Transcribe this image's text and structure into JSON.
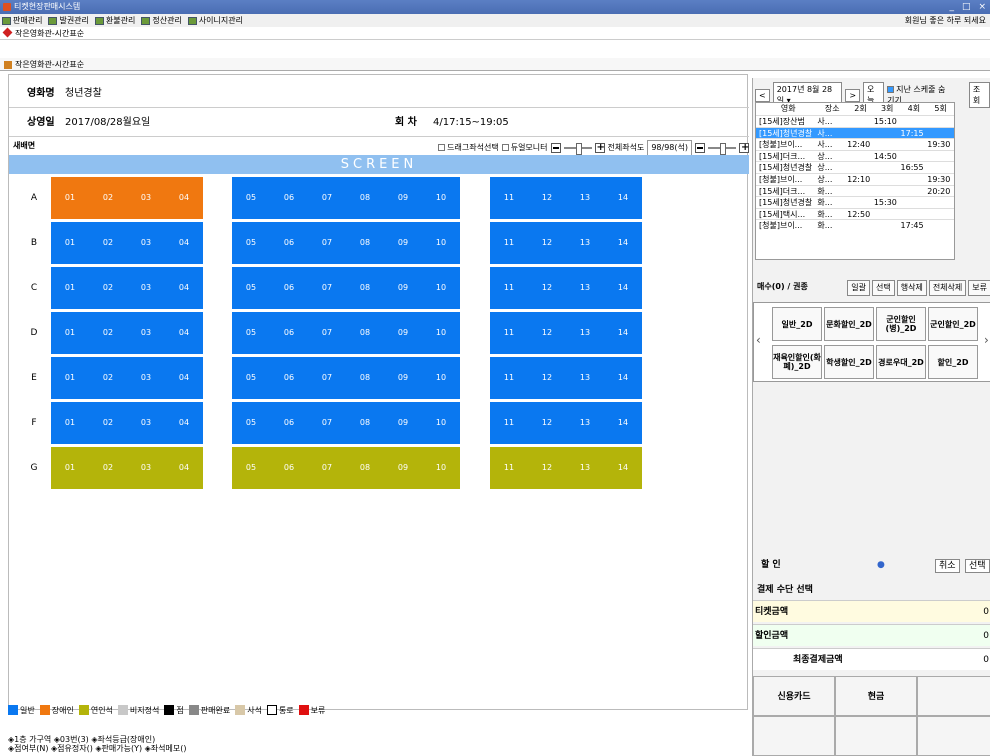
{
  "window": {
    "title": "티켓현장판매시스템",
    "controls": [
      "_",
      "□",
      "×"
    ]
  },
  "menu": {
    "items": [
      "판매관리",
      "발권관리",
      "환불관리",
      "정산관리",
      "사이니지관리"
    ],
    "greeting": "회원님 좋은 하루 되세요"
  },
  "tab": {
    "label": "작은영화관-시간표순"
  },
  "subtitle": "작은영화관-시간표순",
  "info": {
    "movie_label": "영화명",
    "movie": "청년경찰",
    "date_label": "상영일",
    "date": "2017/08/28월요일",
    "session_label": "회 차",
    "session": "4/17:15~19:05"
  },
  "toolbar": {
    "screen_label": "새배면",
    "drag_select": "드래그좌석선택",
    "dual_monitor": "듀얼모니터",
    "full_seat_label": "전체좌석도",
    "seat_count": "98/98(석)"
  },
  "screen_label": "SCREEN",
  "seat_rows": [
    "A",
    "B",
    "C",
    "D",
    "E",
    "F",
    "G"
  ],
  "seat_numbers": [
    "01",
    "02",
    "03",
    "04",
    "05",
    "06",
    "07",
    "08",
    "09",
    "10",
    "11",
    "12",
    "13",
    "14"
  ],
  "colors": {
    "normal": "#0a78f0",
    "disabled": "#f07810",
    "companion": "#b4b40a",
    "screen": "#90c0f0",
    "selected_row": "#3399ff"
  },
  "legend": [
    "일반",
    "장애인",
    "연인석",
    "비지정석",
    "점",
    "판매완료",
    "사석",
    "통로",
    "보류"
  ],
  "status": {
    "line1": "◈1층 가구역  ◈03번(3)  ◈좌석등급(장애인)",
    "line2": "◈점여부(N)  ◈점유정자()  ◈판매가능(Y)  ◈좌석메모()"
  },
  "right": {
    "date": "2017년  8월 28일",
    "today": "오늘",
    "hide_past": "지난 스케줄 숨기기",
    "search": "조회",
    "sched_headers": [
      "영화",
      "장소",
      "2회",
      "3회",
      "4회",
      "5회"
    ],
    "schedule": [
      [
        "[15세]장산범",
        "사...",
        "",
        "15:10",
        "",
        ""
      ],
      [
        "[15세]청년경찰",
        "사...",
        "",
        "",
        "17:15",
        ""
      ],
      [
        "[청불]브이...",
        "사...",
        "12:40",
        "",
        "",
        "19:30"
      ],
      [
        "[15세]더크...",
        "상...",
        "",
        "14:50",
        "",
        ""
      ],
      [
        "[15세]청년경찰",
        "상...",
        "",
        "",
        "16:55",
        ""
      ],
      [
        "[청불]브이...",
        "상...",
        "12:10",
        "",
        "",
        "19:30"
      ],
      [
        "[15세]더크...",
        "화...",
        "",
        "",
        "",
        "20:20"
      ],
      [
        "[15세]청년경찰",
        "화...",
        "",
        "15:30",
        "",
        ""
      ],
      [
        "[15세]택시...",
        "화...",
        "12:50",
        "",
        "",
        ""
      ],
      [
        "[청불]브이...",
        "화...",
        "",
        "",
        "17:45",
        ""
      ]
    ],
    "ticket_label": "매수(0) / 권종",
    "ticket_btns": [
      "일괄",
      "선택",
      "행삭제",
      "전체삭제",
      "보류"
    ],
    "ticket_types": [
      "일반_2D",
      "문화할인_2D",
      "군인할인(병)_2D",
      "군인할인_2D",
      "재육인할인(화폐)_2D",
      "학생할인_2D",
      "경로우대_2D",
      "할인_2D"
    ],
    "discount_label": "할  인",
    "discount_btns": [
      "취소",
      "선택"
    ],
    "pay_header": "결제 수단 선택",
    "ticket_amount": "티켓금액",
    "discount_amount": "할인금액",
    "final_amount": "최종결제금액",
    "zero": "0",
    "card": "신용카드",
    "cash": "현금"
  }
}
